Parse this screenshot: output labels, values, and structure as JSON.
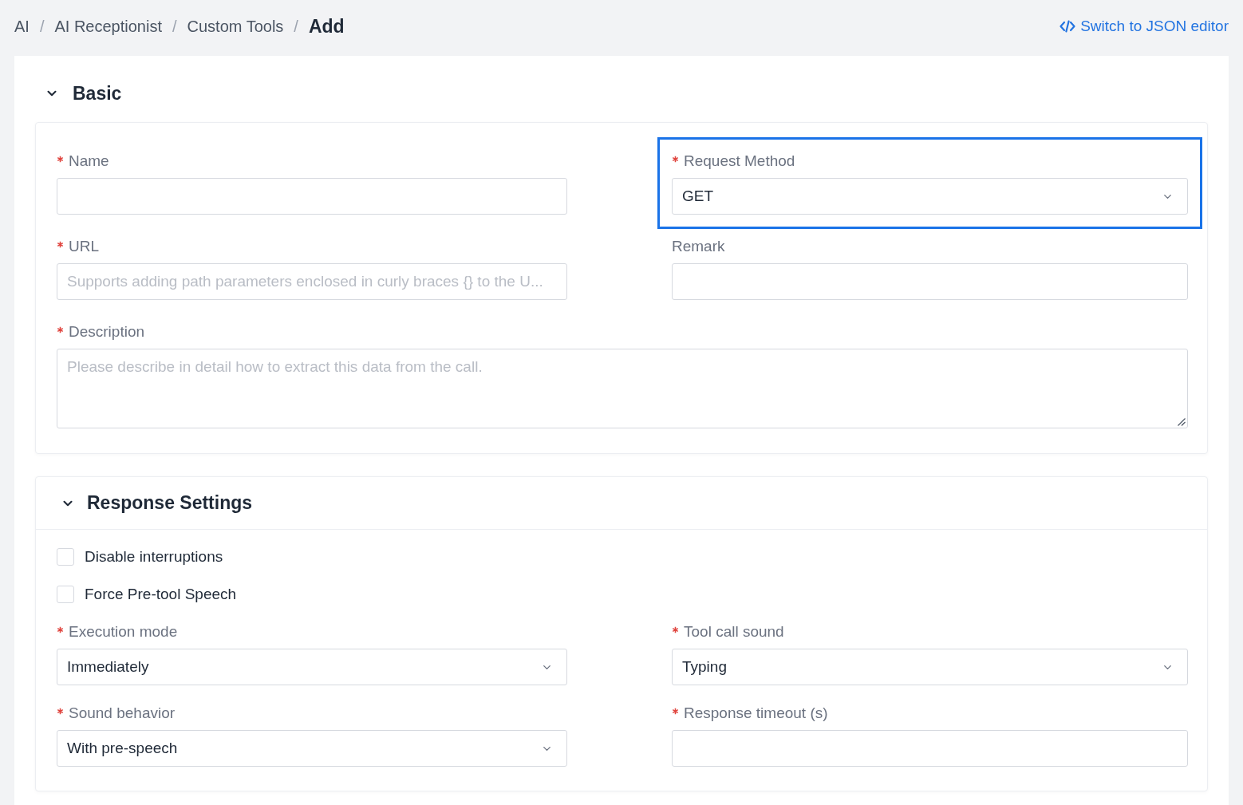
{
  "breadcrumb": [
    {
      "label": "AI",
      "current": false,
      "separator": "/"
    },
    {
      "label": "AI Receptionist",
      "current": false,
      "separator": "/"
    },
    {
      "label": "Custom Tools",
      "current": false,
      "separator": "/"
    },
    {
      "label": "Add",
      "current": true
    }
  ],
  "json_editor_link": {
    "label": "Switch to JSON editor"
  },
  "sections": [
    {
      "kind": "detached",
      "title": "Basic",
      "expanded": true,
      "fields": [
        {
          "kind": "input",
          "label": "Name",
          "required": true,
          "highlighted": false
        },
        {
          "kind": "select",
          "label": "Request Method",
          "required": true,
          "value": "GET",
          "highlighted": true
        },
        {
          "kind": "input",
          "label": "URL",
          "required": true,
          "placeholder": "Supports adding path parameters enclosed in curly braces {} to the U...",
          "highlighted": false
        },
        {
          "kind": "input",
          "label": "Remark",
          "required": false,
          "highlighted": false
        },
        {
          "kind": "textarea",
          "label": "Description",
          "required": true,
          "placeholder": "Please describe in detail how to extract this data from the call.",
          "highlighted": false
        }
      ]
    },
    {
      "kind": "boxed",
      "title": "Response Settings",
      "expanded": true,
      "fields": [
        {
          "kind": "checkbox",
          "label": "Disable interruptions",
          "checked": false
        },
        {
          "kind": "checkbox",
          "label": "Force Pre-tool Speech",
          "checked": false
        },
        {
          "kind": "select",
          "label": "Execution mode",
          "required": true,
          "value": "Immediately",
          "highlighted": false
        },
        {
          "kind": "select",
          "label": "Tool call sound",
          "required": true,
          "value": "Typing",
          "highlighted": false
        },
        {
          "kind": "select",
          "label": "Sound behavior",
          "required": true,
          "value": "With pre-speech",
          "highlighted": false
        },
        {
          "kind": "input",
          "label": "Response timeout (s)",
          "required": true,
          "highlighted": false
        }
      ]
    }
  ]
}
